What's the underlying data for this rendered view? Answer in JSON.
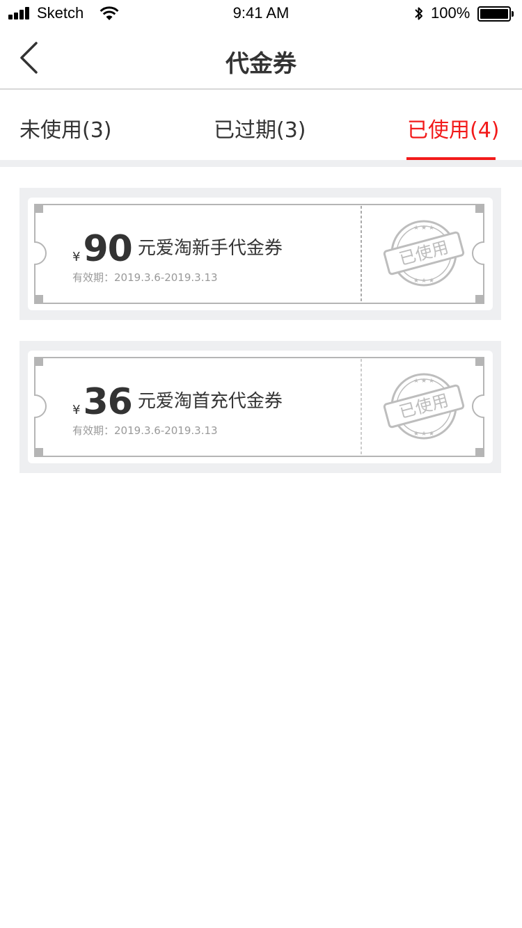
{
  "status_bar": {
    "carrier": "Sketch",
    "time": "9:41 AM",
    "battery": "100%"
  },
  "nav": {
    "title": "代金券"
  },
  "tabs": [
    {
      "label": "未使用(3)",
      "active": false
    },
    {
      "label": "已过期(3)",
      "active": false
    },
    {
      "label": "已使用(4)",
      "active": true
    }
  ],
  "colors": {
    "accent": "#f21a1a",
    "background_gray": "#eeeff1",
    "stamp_gray": "#b5b5b5"
  },
  "coupons": [
    {
      "currency": "¥",
      "amount": "90",
      "name": "元爱淘新手代金券",
      "validity_label": "有效期：",
      "validity_range": "2019.3.6-2019.3.13",
      "stamp_text": "已使用"
    },
    {
      "currency": "¥",
      "amount": "36",
      "name": "元爱淘首充代金券",
      "validity_label": "有效期：",
      "validity_range": "2019.3.6-2019.3.13",
      "stamp_text": "已使用"
    }
  ]
}
